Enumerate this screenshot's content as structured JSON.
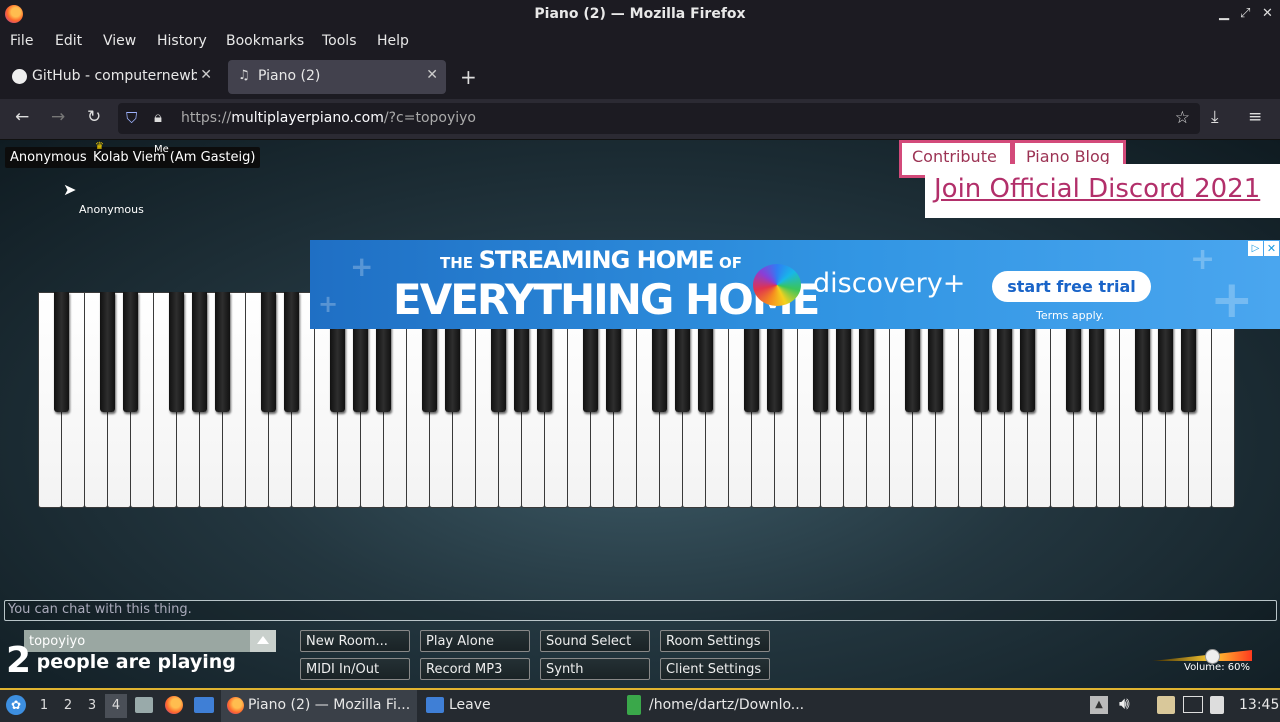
{
  "window": {
    "title": "Piano (2) — Mozilla Firefox"
  },
  "menu": [
    "File",
    "Edit",
    "View",
    "History",
    "Bookmarks",
    "Tools",
    "Help"
  ],
  "tabs": [
    {
      "label": "GitHub - computernewb/"
    },
    {
      "label": "Piano (2)"
    }
  ],
  "url": {
    "scheme": "https://",
    "host": "multiplayerpiano.com",
    "path": "/?c=topoyiyo"
  },
  "players": {
    "p1": "Anonymous",
    "p2": "Kolab Viem (Am Gasteig)",
    "me_tag": "Me",
    "cursor_label": "Anonymous"
  },
  "links": {
    "contribute": "Contribute",
    "blog": "Piano Blog",
    "discord": "Join Official Discord 2021"
  },
  "ad": {
    "line1_a": "THE",
    "line1_b": "STREAMING HOME",
    "line1_c": "OF",
    "line2": "EVERYTHING HOME",
    "brand": "discovery+",
    "cta": "start free trial",
    "terms": "Terms apply."
  },
  "chat": {
    "placeholder": "You can chat with this thing."
  },
  "room": {
    "name": "topoyiyo"
  },
  "buttons": {
    "new_room": "New Room...",
    "play_alone": "Play Alone",
    "sound_select": "Sound Select",
    "room_settings": "Room Settings",
    "midi": "MIDI In/Out",
    "record": "Record MP3",
    "synth": "Synth",
    "client_settings": "Client Settings"
  },
  "status": {
    "count": "2",
    "text": "people are playing"
  },
  "volume": {
    "label": "Volume: 60%",
    "level": 0.6
  },
  "taskbar": {
    "workspaces": [
      "1",
      "2",
      "3",
      "4"
    ],
    "active_workspace": "4",
    "tasks": [
      "Piano (2) — Mozilla Fi...",
      "Leave",
      "/home/dartz/Downlo..."
    ],
    "clock": "13:45"
  },
  "colors": {
    "accent": "#d34a7a",
    "taskbar_accent": "#e0b430"
  }
}
